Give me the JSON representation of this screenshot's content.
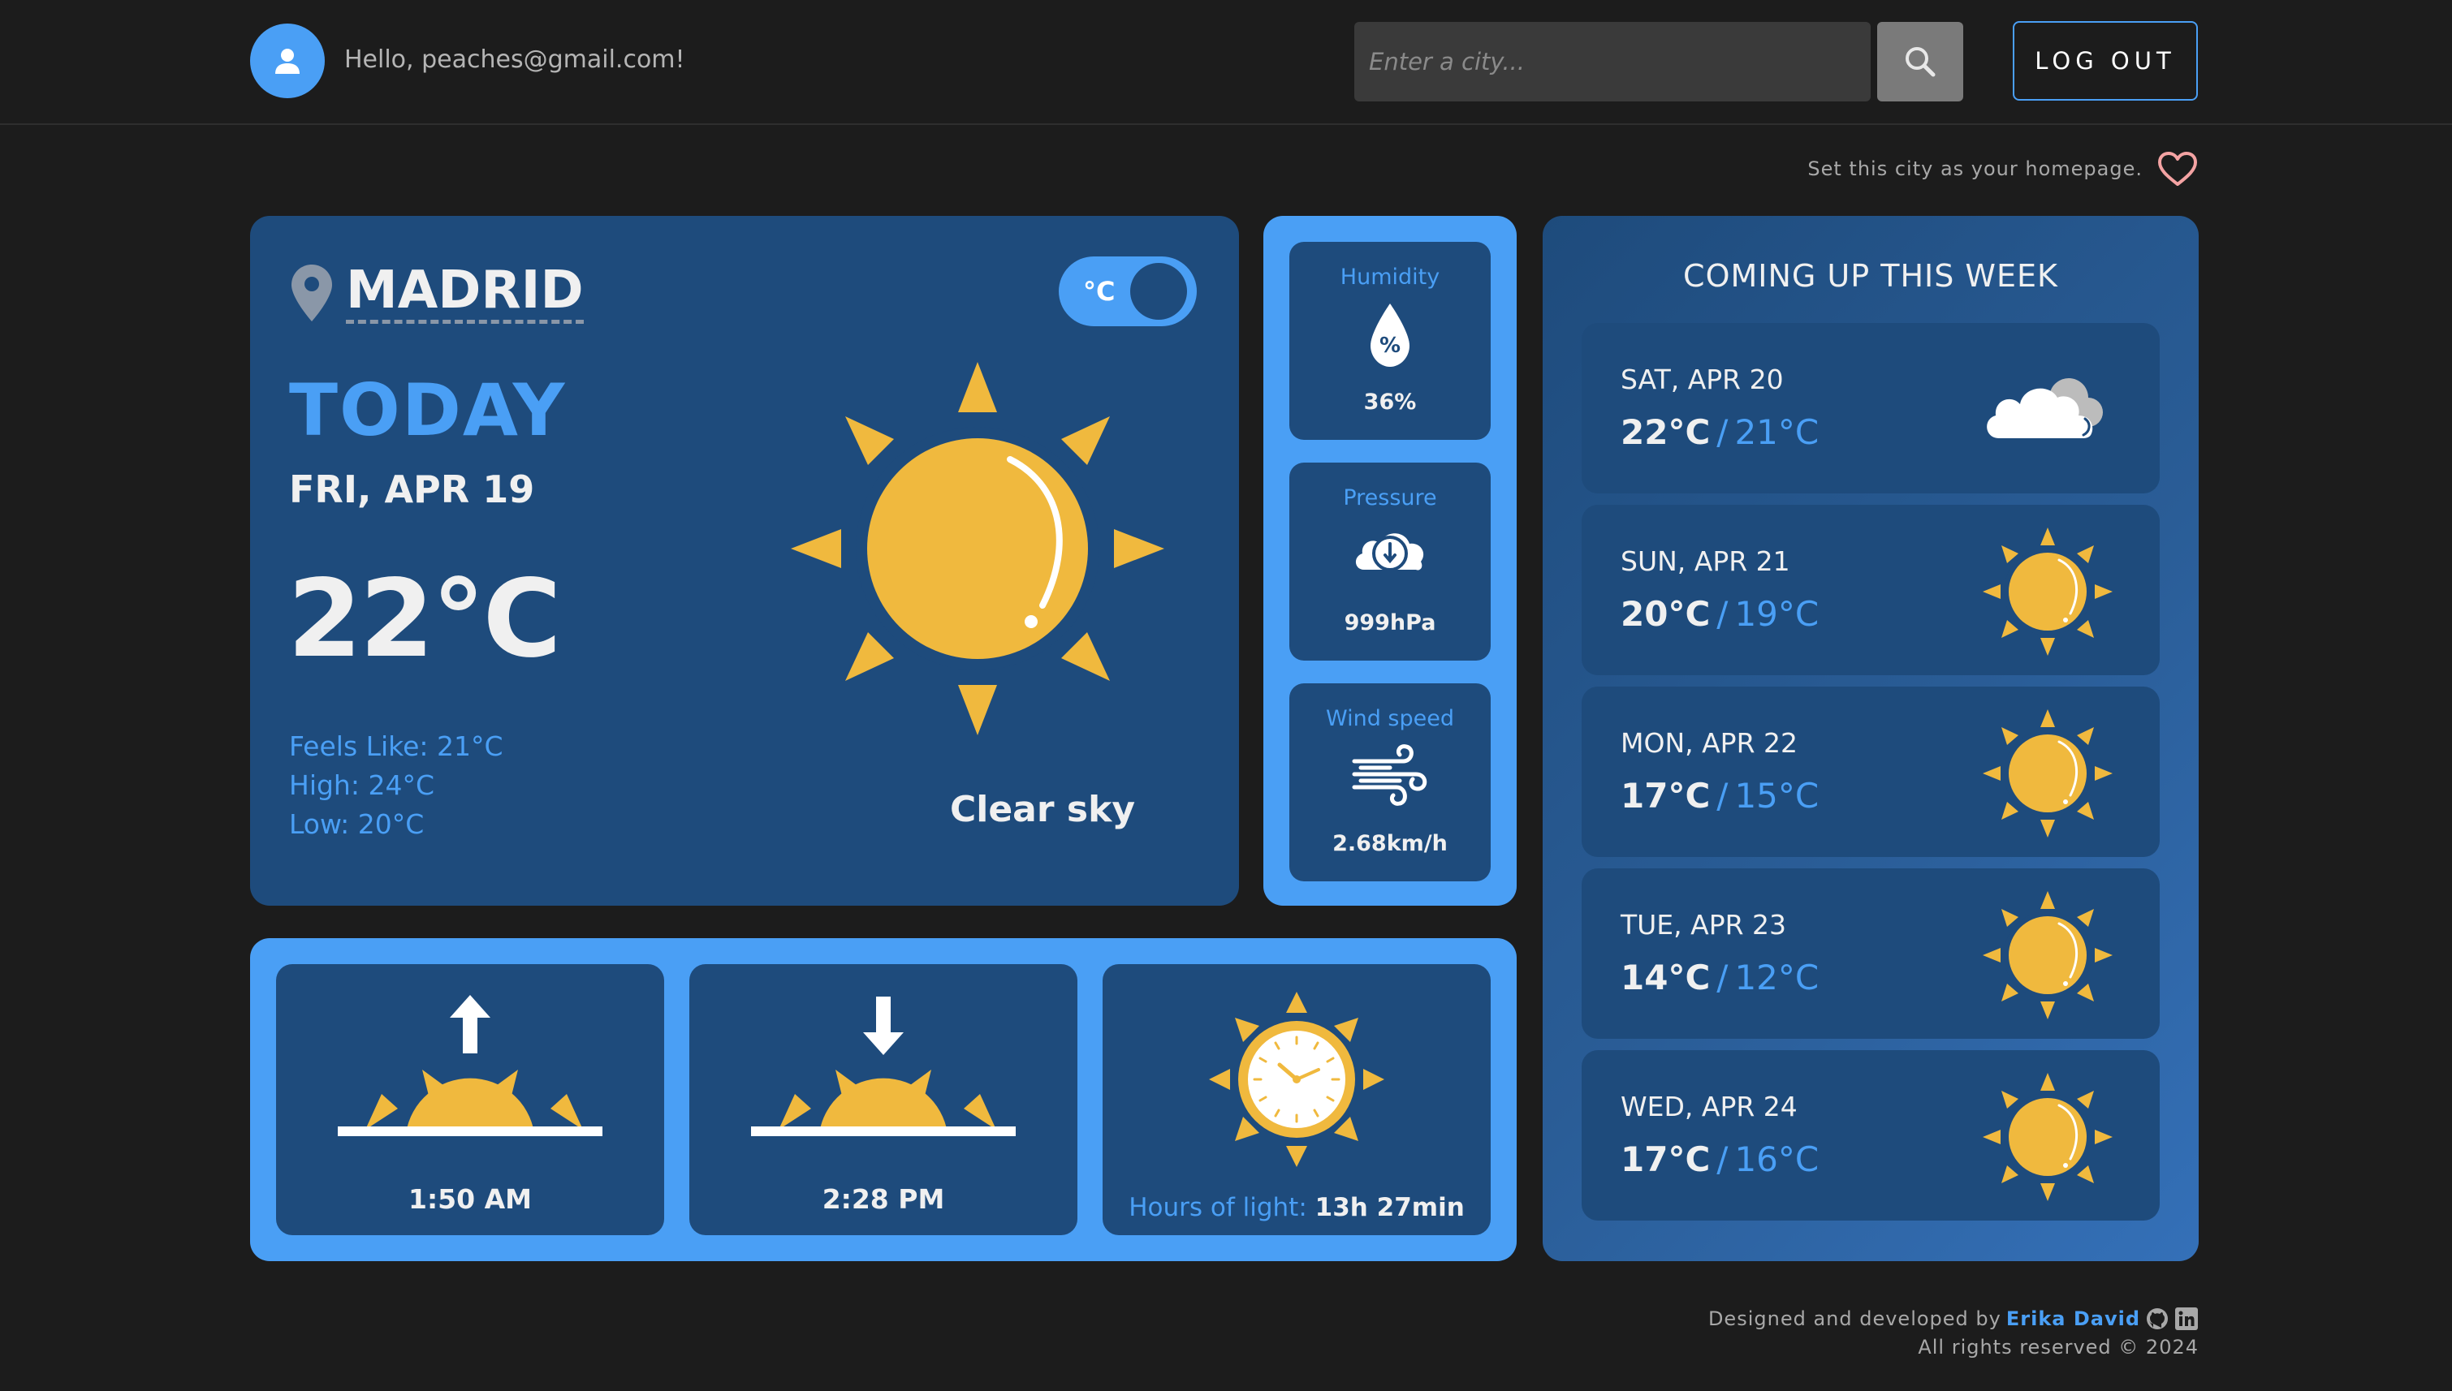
{
  "header": {
    "greeting": "Hello, peaches@gmail.com!",
    "search_placeholder": "Enter a city...",
    "logout_label": "LOG OUT"
  },
  "homepage": {
    "label": "Set this city as your homepage."
  },
  "today": {
    "city": "MADRID",
    "unit": "°C",
    "heading": "TODAY",
    "date": "FRI, APR 19",
    "temperature": "22°C",
    "feels_like": "Feels Like: 21°C",
    "high": "High: 24°C",
    "low": "Low: 20°C",
    "condition": "Clear sky"
  },
  "stats": [
    {
      "title": "Humidity",
      "value": "36%",
      "icon": "water-drop-icon"
    },
    {
      "title": "Pressure",
      "value": "999hPa",
      "icon": "pressure-gauge-icon"
    },
    {
      "title": "Wind speed",
      "value": "2.68km/h",
      "icon": "wind-icon"
    }
  ],
  "sun": {
    "sunrise": "1:50 AM",
    "sunset": "2:28 PM",
    "light_label": "Hours of light:",
    "light_value": "13h 27min"
  },
  "week": {
    "title": "COMING UP THIS WEEK",
    "days": [
      {
        "name": "SAT, APR 20",
        "high": "22°C",
        "low": "21°C",
        "icon": "cloud-icon"
      },
      {
        "name": "SUN, APR 21",
        "high": "20°C",
        "low": "19°C",
        "icon": "sun-icon"
      },
      {
        "name": "MON, APR 22",
        "high": "17°C",
        "low": "15°C",
        "icon": "sun-icon"
      },
      {
        "name": "TUE, APR 23",
        "high": "14°C",
        "low": "12°C",
        "icon": "sun-icon"
      },
      {
        "name": "WED, APR 24",
        "high": "17°C",
        "low": "16°C",
        "icon": "sun-icon"
      }
    ],
    "separator": "/"
  },
  "footer": {
    "designed_by": "Designed and developed by",
    "author": "Erika David",
    "rights": "All rights reserved © 2024"
  },
  "colors": {
    "accent": "#4a9ff5",
    "card": "#1e4b7c",
    "background": "#1c1c1c",
    "sun": "#f0b93e"
  }
}
